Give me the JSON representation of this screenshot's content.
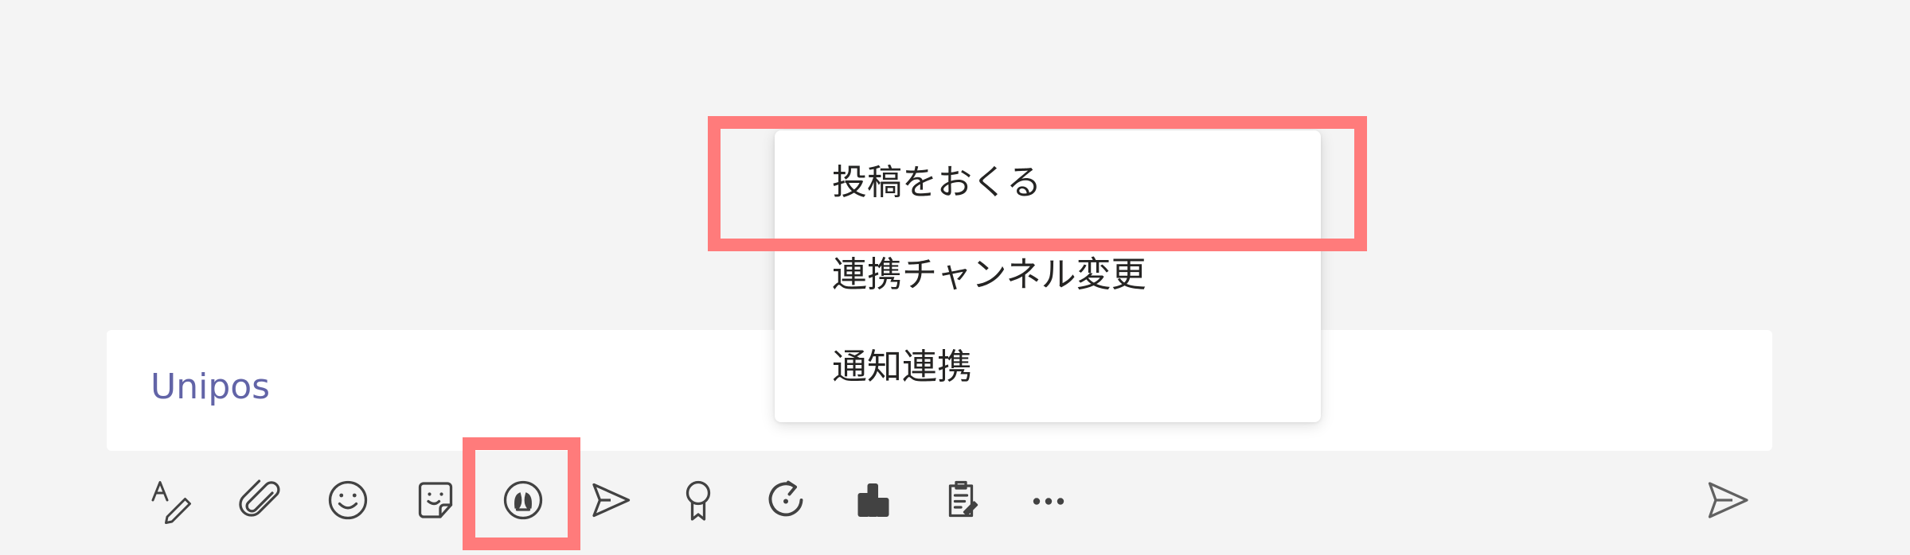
{
  "compose": {
    "text": "Unipos"
  },
  "menu": {
    "items": [
      {
        "label": "投稿をおくる"
      },
      {
        "label": "連携チャンネル変更"
      },
      {
        "label": "通知連携"
      }
    ]
  },
  "toolbar": {
    "icons": [
      "format-icon",
      "attach-icon",
      "emoji-icon",
      "sticker-icon",
      "unipos-app-icon",
      "stream-icon",
      "praise-icon",
      "loop-icon",
      "app-icon",
      "clipboard-icon",
      "more-icon"
    ],
    "send_icon": "send-icon"
  },
  "colors": {
    "background": "#f4f4f4",
    "accent": "#6264a7",
    "highlight": "#ff7b7b",
    "icon": "#424242"
  }
}
